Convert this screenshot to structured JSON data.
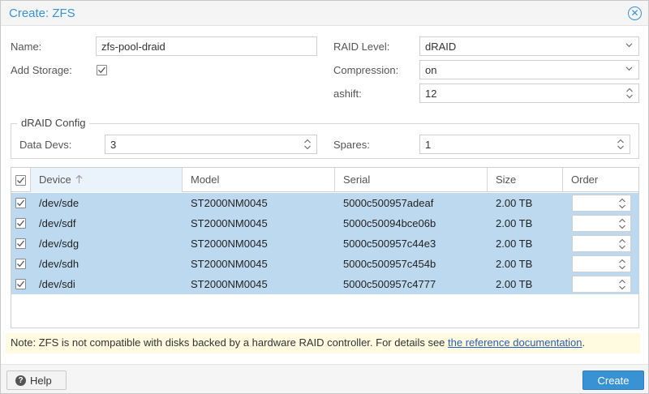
{
  "dialog": {
    "title": "Create: ZFS",
    "close_icon": "close-circle-icon"
  },
  "form": {
    "name_label": "Name:",
    "name_value": "zfs-pool-draid",
    "add_storage_label": "Add Storage:",
    "add_storage_checked": true,
    "raid_level_label": "RAID Level:",
    "raid_level_value": "dRAID",
    "compression_label": "Compression:",
    "compression_value": "on",
    "ashift_label": "ashift:",
    "ashift_value": "12"
  },
  "draid_config": {
    "legend": "dRAID Config",
    "data_devs_label": "Data Devs:",
    "data_devs_value": "3",
    "spares_label": "Spares:",
    "spares_value": "1"
  },
  "grid": {
    "columns": {
      "device": "Device",
      "model": "Model",
      "serial": "Serial",
      "size": "Size",
      "order": "Order"
    },
    "sort_icon": "arrow-up-icon",
    "rows": [
      {
        "device": "/dev/sde",
        "model": "ST2000NM0045",
        "serial": "5000c500957adeaf",
        "size": "2.00 TB",
        "selected": true
      },
      {
        "device": "/dev/sdf",
        "model": "ST2000NM0045",
        "serial": "5000c50094bce06b",
        "size": "2.00 TB",
        "selected": true
      },
      {
        "device": "/dev/sdg",
        "model": "ST2000NM0045",
        "serial": "5000c500957c44e3",
        "size": "2.00 TB",
        "selected": true
      },
      {
        "device": "/dev/sdh",
        "model": "ST2000NM0045",
        "serial": "5000c500957c454b",
        "size": "2.00 TB",
        "selected": true
      },
      {
        "device": "/dev/sdi",
        "model": "ST2000NM0045",
        "serial": "5000c500957c4777",
        "size": "2.00 TB",
        "selected": true
      }
    ]
  },
  "note": {
    "text": "Note: ZFS is not compatible with disks backed by a hardware RAID controller. For details see ",
    "link_text": "the reference documentation",
    "suffix": "."
  },
  "footer": {
    "help_label": "Help",
    "help_icon": "question-circle-icon",
    "create_label": "Create"
  },
  "colors": {
    "accent": "#3892d4",
    "selected_row": "#bdd9ef",
    "note_bg": "#fffbe0"
  }
}
